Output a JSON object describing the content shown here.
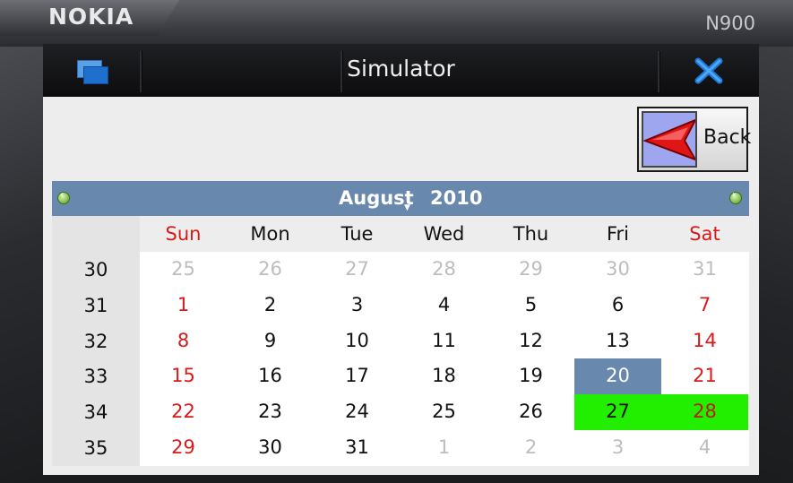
{
  "device": {
    "brand": "NOKIA",
    "model": "N900"
  },
  "window": {
    "title": "Simulator",
    "switcher_icon": "task-switcher-icon",
    "close_icon": "close-icon"
  },
  "toolbar": {
    "back_label": "Back",
    "back_icon": "red-back-arrow-icon"
  },
  "calendar": {
    "month": "August",
    "year": "2010",
    "prev_icon": "prev-month-icon",
    "next_icon": "next-month-icon",
    "weekdays": [
      "Sun",
      "Mon",
      "Tue",
      "Wed",
      "Thu",
      "Fri",
      "Sat"
    ],
    "weeks": [
      {
        "num": "30",
        "days": [
          "25",
          "26",
          "27",
          "28",
          "29",
          "30",
          "31"
        ]
      },
      {
        "num": "31",
        "days": [
          "1",
          "2",
          "3",
          "4",
          "5",
          "6",
          "7"
        ]
      },
      {
        "num": "32",
        "days": [
          "8",
          "9",
          "10",
          "11",
          "12",
          "13",
          "14"
        ]
      },
      {
        "num": "33",
        "days": [
          "15",
          "16",
          "17",
          "18",
          "19",
          "20",
          "21"
        ]
      },
      {
        "num": "34",
        "days": [
          "22",
          "23",
          "24",
          "25",
          "26",
          "27",
          "28"
        ]
      },
      {
        "num": "35",
        "days": [
          "29",
          "30",
          "31",
          "1",
          "2",
          "3",
          "4"
        ]
      }
    ],
    "today": "20",
    "selected": [
      "27",
      "28"
    ],
    "colors": {
      "header": "#6889ad",
      "weekend": "#d81a1a",
      "other_month": "#bdbdbd",
      "selected": "#22ee00"
    }
  }
}
